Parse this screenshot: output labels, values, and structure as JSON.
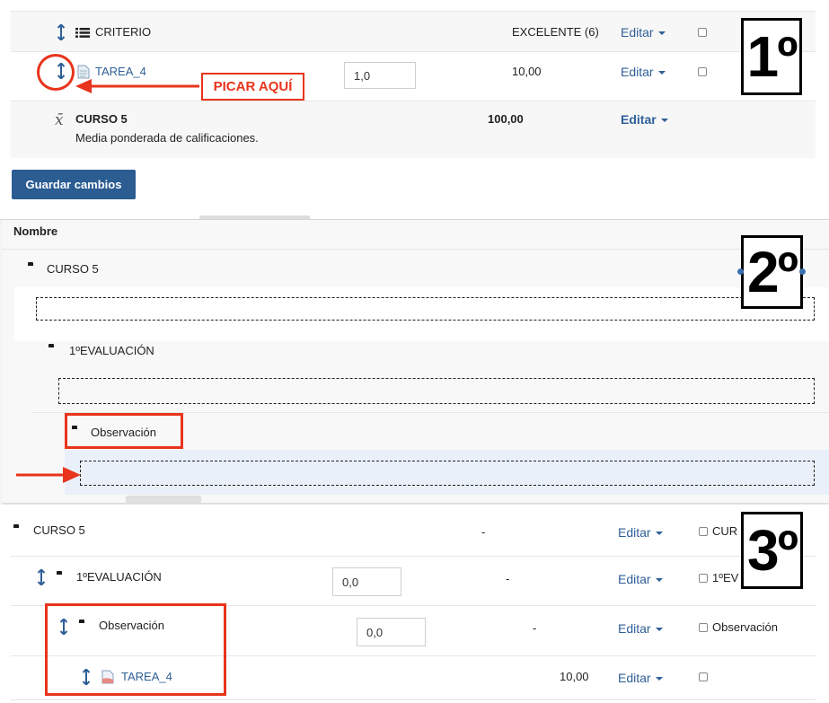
{
  "step1": {
    "number": "1º",
    "criterio": {
      "label": "CRITERIO",
      "value": "EXCELENTE (6)",
      "edit": "Editar"
    },
    "tarea": {
      "label": "TAREA_4",
      "weight": "1,0",
      "max": "10,00",
      "edit": "Editar"
    },
    "curso": {
      "label": "CURSO 5",
      "description": "Media ponderada de calificaciones.",
      "total": "100,00",
      "edit": "Editar"
    },
    "callout": "PICAR AQUÍ",
    "save_button": "Guardar cambios"
  },
  "step2": {
    "number": "2º",
    "header": "Nombre",
    "items": [
      "CURSO 5",
      "1ºEVALUACIÓN",
      "Observación"
    ]
  },
  "step3": {
    "number": "3º",
    "rows": [
      {
        "label": "CURSO 5",
        "weight": "",
        "value": "-",
        "edit": "Editar",
        "checkbox_label": "CUR"
      },
      {
        "label": "1ºEVALUACIÓN",
        "weight": "0,0",
        "value": "-",
        "edit": "Editar",
        "checkbox_label": "1ºEV"
      },
      {
        "label": "Observación",
        "weight": "0,0",
        "value": "-",
        "edit": "Editar",
        "checkbox_label": "Observación"
      },
      {
        "label": "TAREA_4",
        "weight": "",
        "value": "10,00",
        "edit": "Editar",
        "checkbox_label": ""
      }
    ]
  },
  "colors": {
    "link": "#2f5f97",
    "accent_red": "#e8341c",
    "button": "#2b5c92",
    "drop_target": "#e9f0fa"
  }
}
